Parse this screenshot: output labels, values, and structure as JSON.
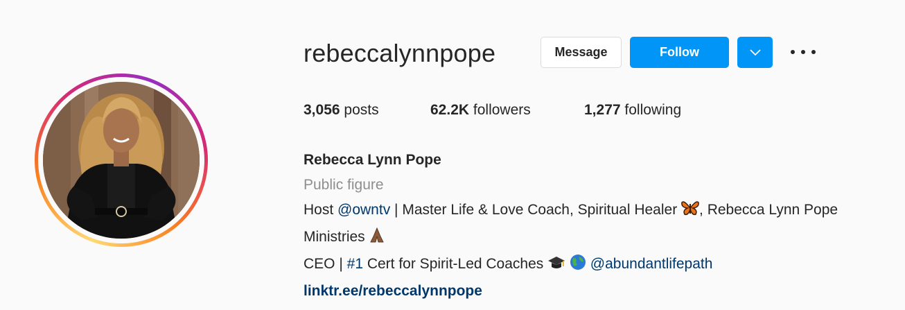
{
  "profile": {
    "username": "rebeccalynnpope",
    "buttons": {
      "message_label": "Message",
      "follow_label": "Follow"
    },
    "stats": {
      "posts_count": "3,056",
      "posts_label": "posts",
      "followers_count": "62.2K",
      "followers_label": "followers",
      "following_count": "1,277",
      "following_label": "following"
    },
    "bio": {
      "full_name": "Rebecca Lynn Pope",
      "category": "Public figure",
      "line1_prefix": "Host ",
      "line1_mention": "@owntv",
      "line1_text": " | Master Life & Love Coach, Spiritual Healer ",
      "line1_suffix": ", Rebecca Lynn Pope",
      "line2_text": "Ministries ",
      "line3_text": "CEO | ",
      "line3_hashtag": "#1",
      "line3_rest": " Cert for Spirit-Led Coaches ",
      "line3_mention": "@abundantlifepath",
      "link": "linktr.ee/rebeccalynnpope"
    }
  },
  "colors": {
    "accent": "#0095f6",
    "link": "#00376b",
    "muted": "#8e8e8e",
    "text": "#262626"
  },
  "icons": [
    "chevron-down-icon",
    "more-icon",
    "butterfly-emoji",
    "praying-hands-emoji",
    "graduation-cap-emoji",
    "globe-emoji"
  ]
}
